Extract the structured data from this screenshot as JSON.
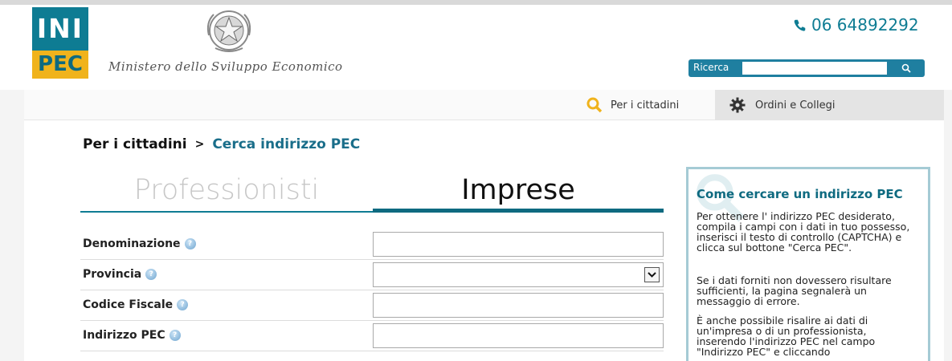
{
  "header": {
    "logo_top": "INI",
    "logo_bottom": "PEC",
    "ministry": "Ministero dello Sviluppo Economico",
    "phone": "06 64892292",
    "search_label": "Ricerca",
    "search_placeholder": ""
  },
  "nav": {
    "tab_cittadini": "Per i cittadini",
    "tab_ordini": "Ordini e Collegi"
  },
  "breadcrumb": {
    "level1": "Per i cittadini",
    "separator": ">",
    "level2": "Cerca indirizzo PEC"
  },
  "tabs": {
    "professionisti": "Professionisti",
    "imprese": "Imprese",
    "active": "Imprese"
  },
  "form": {
    "fields": [
      {
        "label": "Denominazione",
        "value": ""
      },
      {
        "label": "Provincia",
        "value": ""
      },
      {
        "label": "Codice Fiscale",
        "value": ""
      },
      {
        "label": "Indirizzo PEC",
        "value": ""
      }
    ]
  },
  "help": {
    "title": "Come cercare un indirizzo PEC",
    "p1": "Per ottenere l' indirizzo PEC desiderato, compila i campi con i dati in tuo possesso, inserisci il testo di controllo (CAPTCHA) e clicca sul bottone \"Cerca PEC\".",
    "p2": "Se i dati forniti non dovessero risultare sufficienti, la pagina segnalerà un messaggio di errore.",
    "p3": "È anche possibile risalire ai dati di un'impresa o di un professionista, inserendo l'indirizzo PEC nel campo \"Indirizzo PEC\" e cliccando"
  },
  "colors": {
    "brand_teal": "#0e7c93",
    "brand_yellow": "#f0b31c",
    "search_blue": "#1f7fa0",
    "link_teal": "#1a6e8a"
  }
}
